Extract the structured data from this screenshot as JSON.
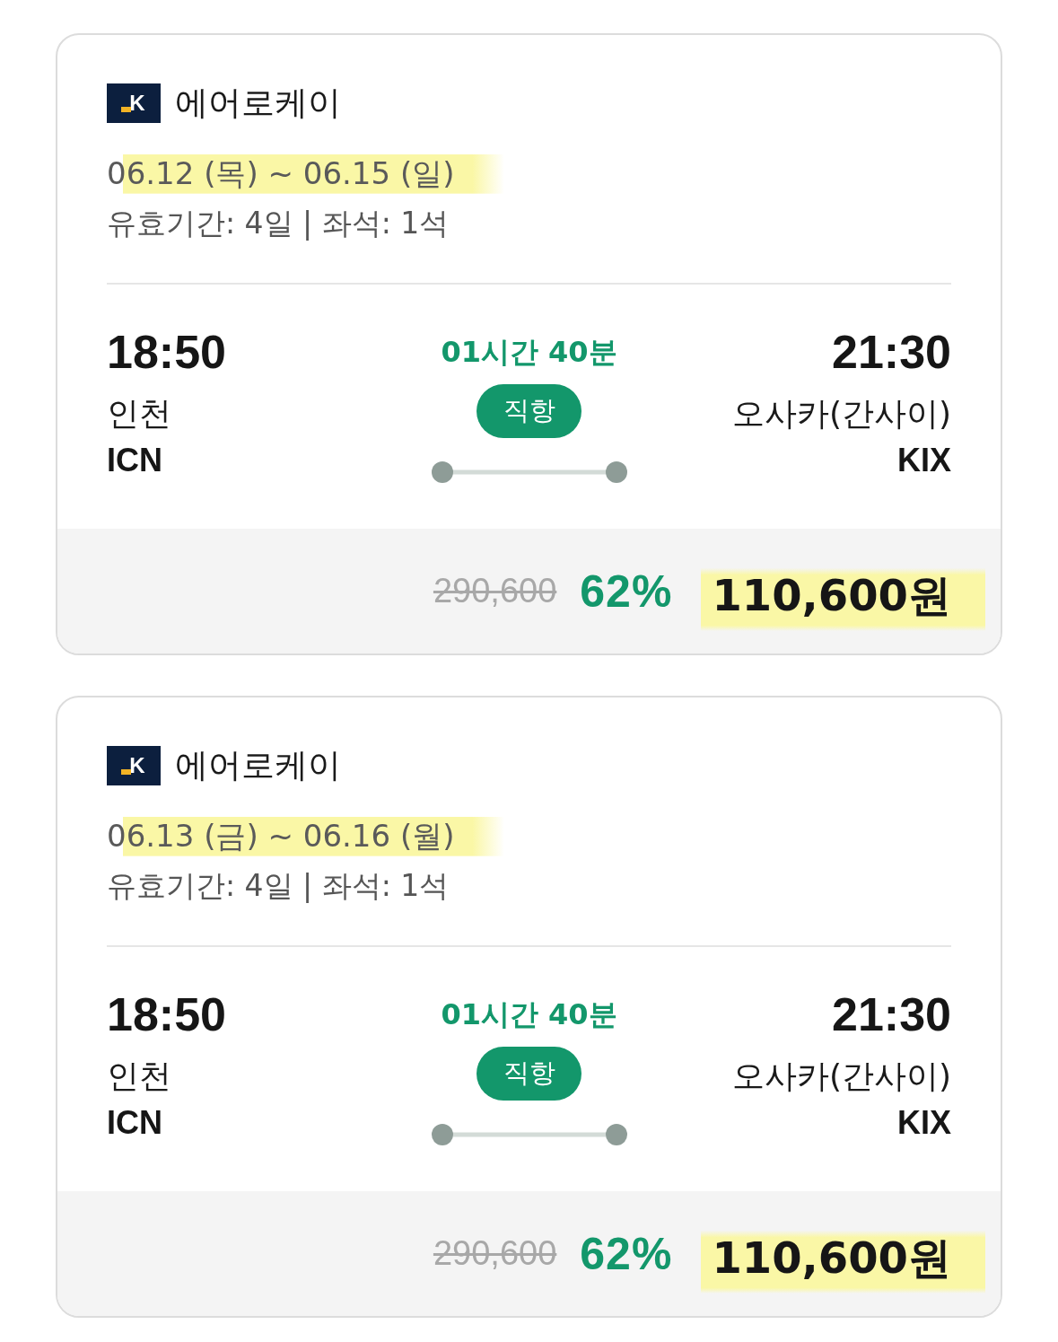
{
  "cards": [
    {
      "airline": {
        "logo_text": "K",
        "name": "에어로케이"
      },
      "dates": {
        "text": "06.12 (목) ~ 06.15 (일)",
        "highlighted": true
      },
      "info": "유효기간: 4일 | 좌석: 1석",
      "departure": {
        "time": "18:50",
        "city": "인천",
        "code": "ICN"
      },
      "duration": "01시간 40분",
      "flight_type": "직항",
      "arrival": {
        "time": "21:30",
        "city": "오사카(간사이)",
        "code": "KIX"
      },
      "price": {
        "original": "290,600",
        "discount": "62%",
        "final": "110,600원",
        "highlighted": true
      }
    },
    {
      "airline": {
        "logo_text": "K",
        "name": "에어로케이"
      },
      "dates": {
        "text": "06.13 (금) ~ 06.16 (월)",
        "highlighted": true
      },
      "info": "유효기간: 4일 | 좌석: 1석",
      "departure": {
        "time": "18:50",
        "city": "인천",
        "code": "ICN"
      },
      "duration": "01시간 40분",
      "flight_type": "직항",
      "arrival": {
        "time": "21:30",
        "city": "오사카(간사이)",
        "code": "KIX"
      },
      "price": {
        "original": "290,600",
        "discount": "62%",
        "final": "110,600원",
        "highlighted": true
      }
    }
  ]
}
